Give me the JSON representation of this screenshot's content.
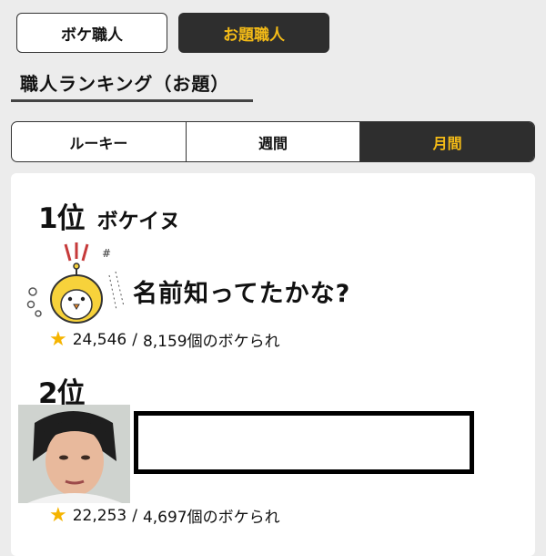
{
  "top_tabs": [
    {
      "label": "ボケ職人",
      "active": false
    },
    {
      "label": "お題職人",
      "active": true
    }
  ],
  "section_title": "職人ランキング（お題）",
  "period_tabs": [
    {
      "label": "ルーキー",
      "active": false
    },
    {
      "label": "週間",
      "active": false
    },
    {
      "label": "月間",
      "active": true
    }
  ],
  "rankings": [
    {
      "rank": "1位",
      "name": "ボケイヌ",
      "odai_text": "名前知ってたかな?",
      "image": "cartoon-chick-sticker",
      "stars": "24,546",
      "bokes": "8,159個のボケられ"
    },
    {
      "rank": "2位",
      "image": "woman-portrait-photo",
      "stars": "22,253",
      "bokes": "4,697個のボケられ"
    }
  ],
  "colors": {
    "accent": "#f4bb17",
    "dark": "#2e2e2e",
    "star": "#f5b400",
    "background": "#ececec"
  }
}
